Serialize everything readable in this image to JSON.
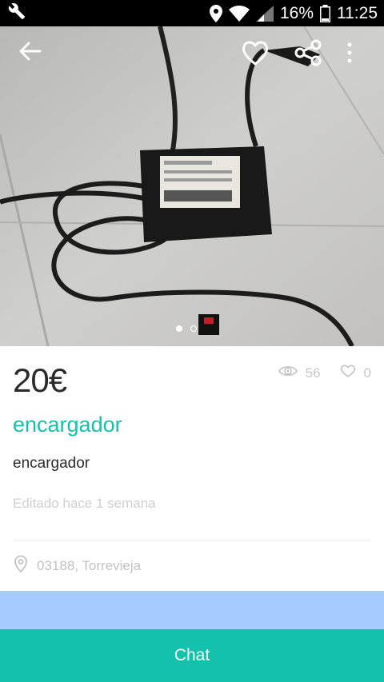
{
  "status_bar": {
    "battery": "16%",
    "time": "11:25",
    "icons": [
      "wrench-icon",
      "location-pin-icon",
      "wifi-icon",
      "signal-icon",
      "battery-icon"
    ]
  },
  "header_actions": [
    "back-arrow-icon",
    "heart-outline-icon",
    "share-icon",
    "more-vertical-icon"
  ],
  "gallery": {
    "image_count": 2,
    "current_index": 1
  },
  "listing": {
    "price": "20€",
    "views": "56",
    "favorites": "0",
    "title": "encargador",
    "description": "encargador",
    "edited": "Editado hace 1 semana",
    "location": "03188, Torrevieja"
  },
  "chat_button": {
    "label": "Chat"
  },
  "colors": {
    "accent": "#13c1ac",
    "map": "#a6cbff",
    "muted": "#c7c7c7"
  }
}
